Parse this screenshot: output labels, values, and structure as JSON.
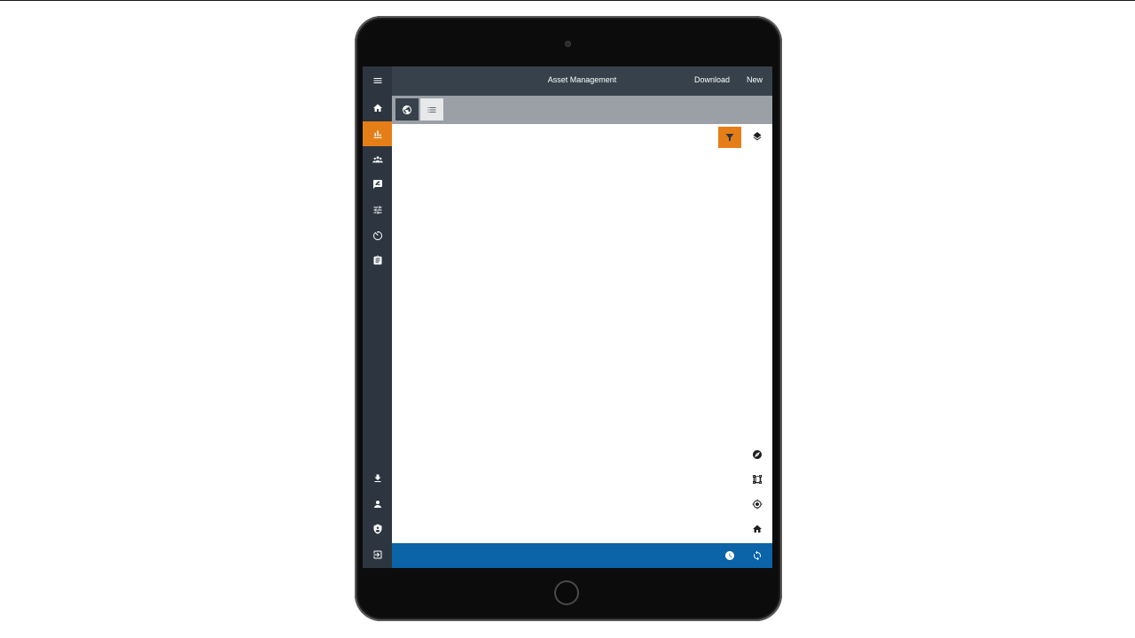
{
  "appbar": {
    "title": "Asset Management",
    "download_label": "Download",
    "new_label": "New"
  },
  "sidebar": {
    "items": [
      {
        "icon": "menu-icon"
      },
      {
        "icon": "home-icon"
      },
      {
        "icon": "bar-chart-icon",
        "active": true
      },
      {
        "icon": "group-icon"
      },
      {
        "icon": "feedback-icon"
      },
      {
        "icon": "sliders-icon"
      },
      {
        "icon": "timer-icon"
      },
      {
        "icon": "clipboard-icon"
      },
      {
        "icon": "download-icon"
      },
      {
        "icon": "user-icon"
      },
      {
        "icon": "shield-user-icon"
      },
      {
        "icon": "logout-icon"
      }
    ]
  },
  "view_toggle": {
    "selected": "map",
    "options": [
      {
        "icon": "globe-icon"
      },
      {
        "icon": "list-icon"
      }
    ]
  },
  "map_tools": [
    "filter-icon",
    "layers-icon",
    "compass-icon",
    "select-area-icon",
    "locate-icon",
    "map-home-icon"
  ],
  "status_bar": [
    "clock-icon",
    "sync-icon"
  ],
  "colors": {
    "sidebar": "#2d3640",
    "appbar": "#36414b",
    "accent": "#e67e17",
    "viewbar": "#9aa0a6",
    "statusbar": "#0b63a8"
  }
}
